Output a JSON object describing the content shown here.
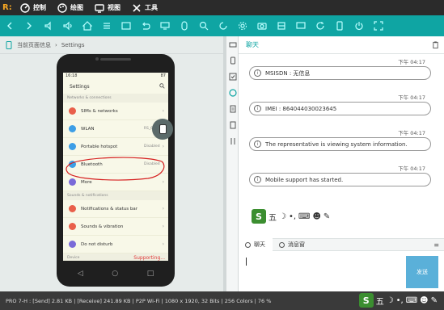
{
  "menubar": {
    "items": [
      {
        "label": "控制",
        "icon": "gauge-icon"
      },
      {
        "label": "绘图",
        "icon": "palette-icon"
      },
      {
        "label": "视图",
        "icon": "monitor-icon"
      },
      {
        "label": "工具",
        "icon": "tools-icon"
      }
    ]
  },
  "breadcrumb": {
    "current": "当前页面信息",
    "page": "Settings"
  },
  "phone": {
    "status_time": "16:18",
    "status_right": "87",
    "app_title": "Settings",
    "section1": "Networks & connections",
    "section2": "Sounds & notifications",
    "section3": "Device",
    "rows": [
      {
        "label": "SIMs & networks",
        "value": "",
        "color": "#e95f4a"
      },
      {
        "label": "WLAN",
        "value": "RS_6418",
        "color": "#3d9ee6"
      },
      {
        "label": "Portable hotspot",
        "value": "Disabled",
        "color": "#3d9ee6"
      },
      {
        "label": "Bluetooth",
        "value": "Disabled",
        "color": "#3d9ee6"
      },
      {
        "label": "More",
        "value": "",
        "color": "#7a6ad8"
      },
      {
        "label": "Notifications & status bar",
        "value": "",
        "color": "#e95f4a"
      },
      {
        "label": "Sounds & vibration",
        "value": "",
        "color": "#e95f4a"
      },
      {
        "label": "Do not disturb",
        "value": "",
        "color": "#7a6ad8"
      }
    ],
    "supporting": "Supporting..."
  },
  "chat": {
    "title": "聊天",
    "messages": [
      {
        "time": "下午 04:17",
        "text": "MSISDN : 无信息"
      },
      {
        "time": "下午 04:17",
        "text": "IMEI : 864044030023645"
      },
      {
        "time": "下午 04:17",
        "text": "The representative is viewing system information."
      },
      {
        "time": "下午 04:17",
        "text": "Mobile support has started."
      }
    ],
    "tabs": [
      {
        "label": "聊天"
      },
      {
        "label": "消息窗"
      }
    ],
    "send_label": "发送",
    "ime_label": "五"
  },
  "status": {
    "text": "PRO 7-H : [Send] 2.81 KB  |  [Receive] 241.89 KB  |  P2P Wi-Fi  |  1080 x 1920, 32 Bits  |  256 Colors  |  76 %"
  }
}
